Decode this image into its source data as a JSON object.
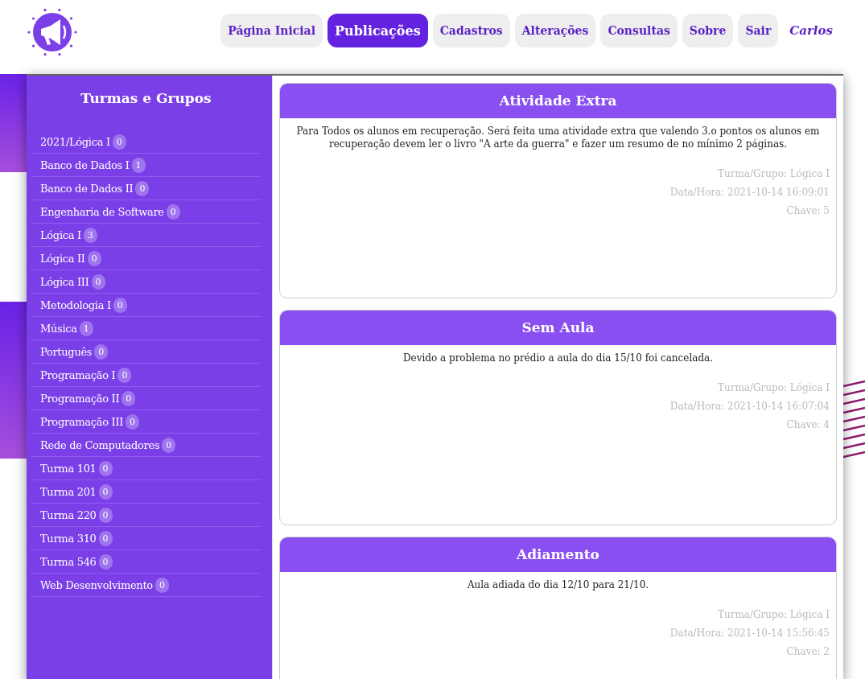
{
  "nav": [
    {
      "label": "Página Inicial",
      "selected": false
    },
    {
      "label": "Publicações",
      "selected": true
    },
    {
      "label": "Cadastros",
      "selected": false
    },
    {
      "label": "Alterações",
      "selected": false
    },
    {
      "label": "Consultas",
      "selected": false
    },
    {
      "label": "Sobre",
      "selected": false
    },
    {
      "label": "Sair",
      "selected": false
    }
  ],
  "user": "Carlos",
  "sidebar": {
    "title": "Turmas e Grupos",
    "items": [
      {
        "label": "2021/Lógica I",
        "count": "0"
      },
      {
        "label": "Banco de Dados I",
        "count": "1"
      },
      {
        "label": "Banco de Dados II",
        "count": "0"
      },
      {
        "label": "Engenharia de Software",
        "count": "0"
      },
      {
        "label": "Lógica I",
        "count": "3"
      },
      {
        "label": "Lógica II",
        "count": "0"
      },
      {
        "label": "Lógica III",
        "count": "0"
      },
      {
        "label": "Metodologia I",
        "count": "0"
      },
      {
        "label": "Música",
        "count": "1"
      },
      {
        "label": "Português",
        "count": "0"
      },
      {
        "label": "Programação I",
        "count": "0"
      },
      {
        "label": "Programação II",
        "count": "0"
      },
      {
        "label": "Programação III",
        "count": "0"
      },
      {
        "label": "Rede de Computadores",
        "count": "0"
      },
      {
        "label": "Turma 101",
        "count": "0"
      },
      {
        "label": "Turma 201",
        "count": "0"
      },
      {
        "label": "Turma 220",
        "count": "0"
      },
      {
        "label": "Turma 310",
        "count": "0"
      },
      {
        "label": "Turma 546",
        "count": "0"
      },
      {
        "label": "Web Desenvolvimento",
        "count": "0"
      }
    ]
  },
  "posts": [
    {
      "title": "Atividade Extra",
      "body": "Para Todos os alunos em recuperação. Será feita uma atividade extra que valendo 3.o pontos os alunos em recuperação devem ler o livro \"A arte da guerra\" e fazer um resumo de no mínimo 2 páginas.",
      "group": "Turma/Grupo: Lógica I",
      "datetime": "Data/Hora: 2021-10-14 16:09:01",
      "key": "Chave: 5"
    },
    {
      "title": "Sem Aula",
      "body": "Devido a problema no prédio a aula do dia 15/10 foi cancelada.",
      "group": "Turma/Grupo: Lógica I",
      "datetime": "Data/Hora: 2021-10-14 16:07:04",
      "key": "Chave: 4"
    },
    {
      "title": "Adiamento",
      "body": "Aula adiada do dia 12/10 para 21/10.",
      "group": "Turma/Grupo: Lógica I",
      "datetime": "Data/Hora: 2021-10-14 15:56:45",
      "key": "Chave: 2"
    }
  ]
}
